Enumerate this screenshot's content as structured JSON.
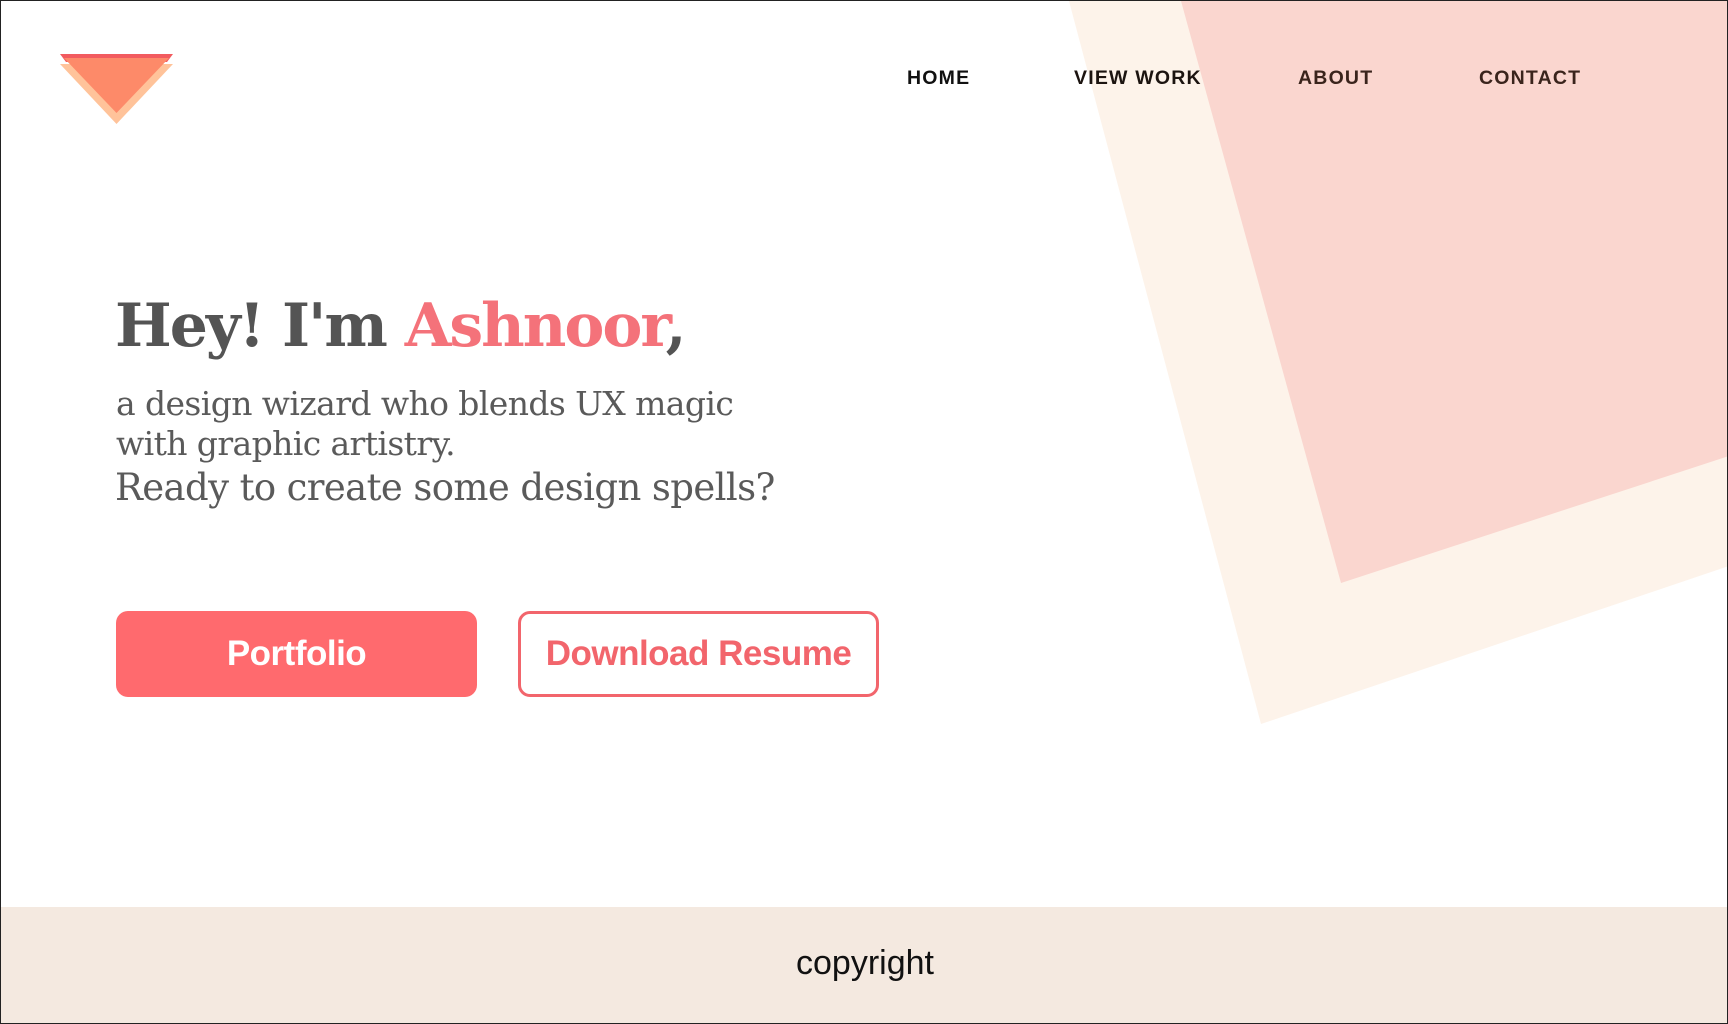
{
  "colors": {
    "accent": "#ff6a6e",
    "accent_text": "#f4727a",
    "shape_light": "#fdf3ea",
    "shape_pink": "#fad6cf",
    "footer_bg": "#f4e9e0",
    "heading": "#545454"
  },
  "logo": {
    "icon": "layered-triangle-logo-icon"
  },
  "nav": {
    "items": [
      {
        "label": "HOME"
      },
      {
        "label": "VIEW WORK"
      },
      {
        "label": "ABOUT"
      },
      {
        "label": "CONTACT"
      }
    ]
  },
  "hero": {
    "greeting": "Hey! I'm ",
    "name": "Ashnoor",
    "comma": ",",
    "subtitle": "a design wizard who blends UX magic with graphic artistry.",
    "question": "Ready to create some design spells?"
  },
  "buttons": {
    "primary_label": "Portfolio",
    "secondary_label": "Download Resume"
  },
  "footer": {
    "text": "copyright"
  }
}
